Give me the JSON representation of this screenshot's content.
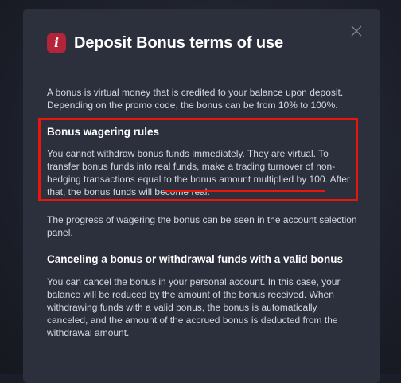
{
  "dialog": {
    "title": "Deposit Bonus terms of use",
    "badge_glyph": "i",
    "badge_icon": "info-icon",
    "close_icon": "close-icon",
    "intro_line_1": "A bonus is virtual money that is credited to your balance upon deposit.",
    "intro_line_2": "Depending on the promo code, the bonus can be from 10% to 100%.",
    "wagering": {
      "heading": "Bonus wagering rules",
      "lines": [
        "You cannot withdraw bonus funds immediately. They are virtual. To",
        "transfer bonus funds into real funds, make a trading turnover of non-",
        "hedging transactions equal to the bonus amount multiplied by 100. After",
        "that, the bonus funds will become real."
      ]
    },
    "progress_lines": [
      "The progress of wagering the bonus can be seen in the account selection",
      "panel."
    ],
    "canceling": {
      "heading": "Canceling a bonus or withdrawal funds with a valid bonus",
      "lines": [
        "You can cancel the bonus in your personal account. In this case, your",
        "balance will be reduced by the amount of the bonus received. When",
        "withdrawing funds with a valid bonus, the bonus is automatically",
        "canceled, and the amount of the accrued bonus is deducted from the",
        "withdrawal amount."
      ]
    }
  },
  "colors": {
    "modal_background": "#2c303d",
    "badge": "#b3243b",
    "highlight": "#e8170d",
    "body_text": "#d4d7de",
    "heading_text": "#ffffff"
  }
}
